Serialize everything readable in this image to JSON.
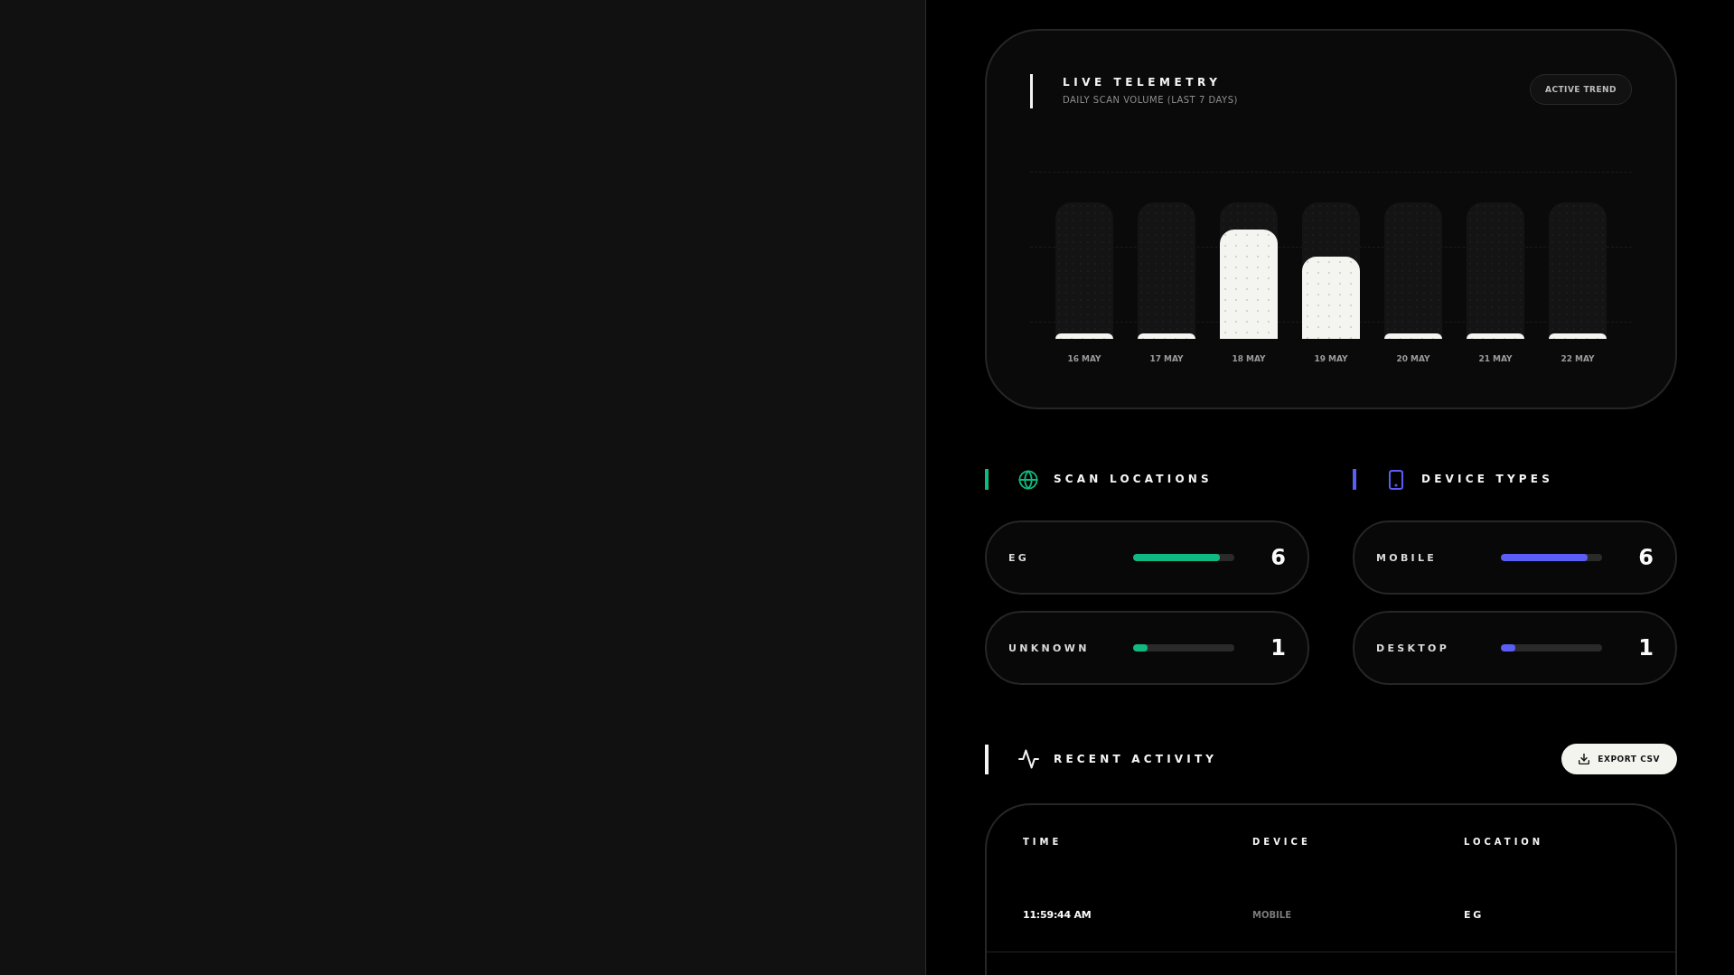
{
  "telemetry": {
    "title": "LIVE TELEMETRY",
    "subtitle": "DAILY SCAN VOLUME (LAST 7 DAYS)",
    "badge": "ACTIVE TREND",
    "days": [
      {
        "label": "16 MAY",
        "level": 0.04
      },
      {
        "label": "17 MAY",
        "level": 0.04
      },
      {
        "label": "18 MAY",
        "level": 0.8
      },
      {
        "label": "19 MAY",
        "level": 0.6
      },
      {
        "label": "20 MAY",
        "level": 0.04
      },
      {
        "label": "21 MAY",
        "level": 0.04
      },
      {
        "label": "22 MAY",
        "level": 0.04
      }
    ]
  },
  "breakdowns": [
    {
      "kind": "locations",
      "title": "SCAN LOCATIONS",
      "color": "#10b981",
      "rows": [
        {
          "label": "EG",
          "level": 0.86,
          "count": "6"
        },
        {
          "label": "UNKNOWN",
          "level": 0.14,
          "count": "1"
        }
      ]
    },
    {
      "kind": "devices",
      "title": "DEVICE TYPES",
      "color": "#5b5ef4",
      "rows": [
        {
          "label": "MOBILE",
          "level": 0.86,
          "count": "6"
        },
        {
          "label": "DESKTOP",
          "level": 0.14,
          "count": "1"
        }
      ]
    }
  ],
  "activity": {
    "title": "RECENT ACTIVITY",
    "export_button": "EXPORT CSV",
    "columns": [
      "TIME",
      "DEVICE",
      "LOCATION"
    ],
    "rows": [
      [
        "11:59:44 AM",
        "MOBILE",
        "EG"
      ]
    ]
  }
}
